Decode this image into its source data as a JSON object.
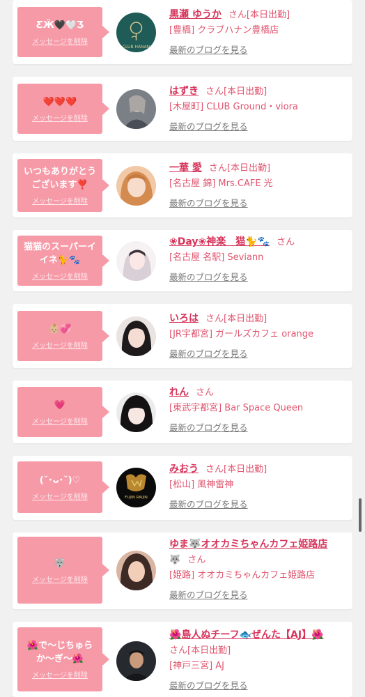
{
  "entries": [
    {
      "message": "ƸӜ🖤🤍Ʒ",
      "delete_label": "メッセージを削除",
      "name": "黒瀬 ゆうか",
      "san": "さん",
      "status": "[本日出勤]",
      "shop": "[豊橋] クラブハナン豊橋店",
      "blog_label": "最新のブログを見る",
      "avatar_text": "CLUB HANAN"
    },
    {
      "message": "❤️❤️❤️",
      "delete_label": "メッセージを削除",
      "name": "はずき",
      "san": "さん",
      "status": "[本日出勤]",
      "shop": "[木屋町] CLUB Ground・viora",
      "blog_label": "最新のブログを見る"
    },
    {
      "message": "いつもありがとう\nございます❣️",
      "delete_label": "メッセージを削除",
      "name": "一華 愛",
      "san": "さん",
      "status": "[本日出勤]",
      "shop": "[名古屋 錦] Mrs.CAFE 光",
      "blog_label": "最新のブログを見る"
    },
    {
      "message": "猫猫のスーパーイ\nイネ🐈🐾",
      "delete_label": "メッセージを削除",
      "name": "❀Day❀神楽　猫🐈🐾",
      "san": "さん",
      "status": "",
      "shop": "[名古屋 名駅] Seviann",
      "blog_label": "最新のブログを見る"
    },
    {
      "message": "👶🏼💞",
      "delete_label": "メッセージを削除",
      "name": "いろは",
      "san": "さん",
      "status": "[本日出勤]",
      "shop": "[JR宇都宮] ガールズカフェ orange",
      "blog_label": "最新のブログを見る"
    },
    {
      "message": "💗",
      "delete_label": "メッセージを削除",
      "name": "れん",
      "san": "さん",
      "status": "",
      "shop": "[東武宇都宮] Bar Space Queen",
      "blog_label": "最新のブログを見る"
    },
    {
      "message": "(˘･ᴗ･˘)♡",
      "delete_label": "メッセージを削除",
      "name": "みおう",
      "san": "さん",
      "status": "[本日出勤]",
      "shop": "[松山] 風神雷神",
      "blog_label": "最新のブログを見る",
      "avatar_text": "FUJIN RAIJIN"
    },
    {
      "message": "🐺",
      "delete_label": "メッセージを削除",
      "name": "ゆま🐺オオカミちゃんカフェ姫路店",
      "name_extra": "🐺",
      "san": "さん",
      "status": "",
      "shop": "[姫路] オオカミちゃんカフェ姫路店",
      "blog_label": "最新のブログを見る"
    },
    {
      "message": "🌺で〜じちゅら\nか〜ぎ〜🌺",
      "delete_label": "メッセージを削除",
      "name": "🌺島人ぬチーフ🐟ぜんた【AJ】🌺",
      "san": "さん",
      "status": "[本日出勤]",
      "shop": "[神戸三宮] AJ",
      "blog_label": "最新のブログを見る"
    }
  ]
}
